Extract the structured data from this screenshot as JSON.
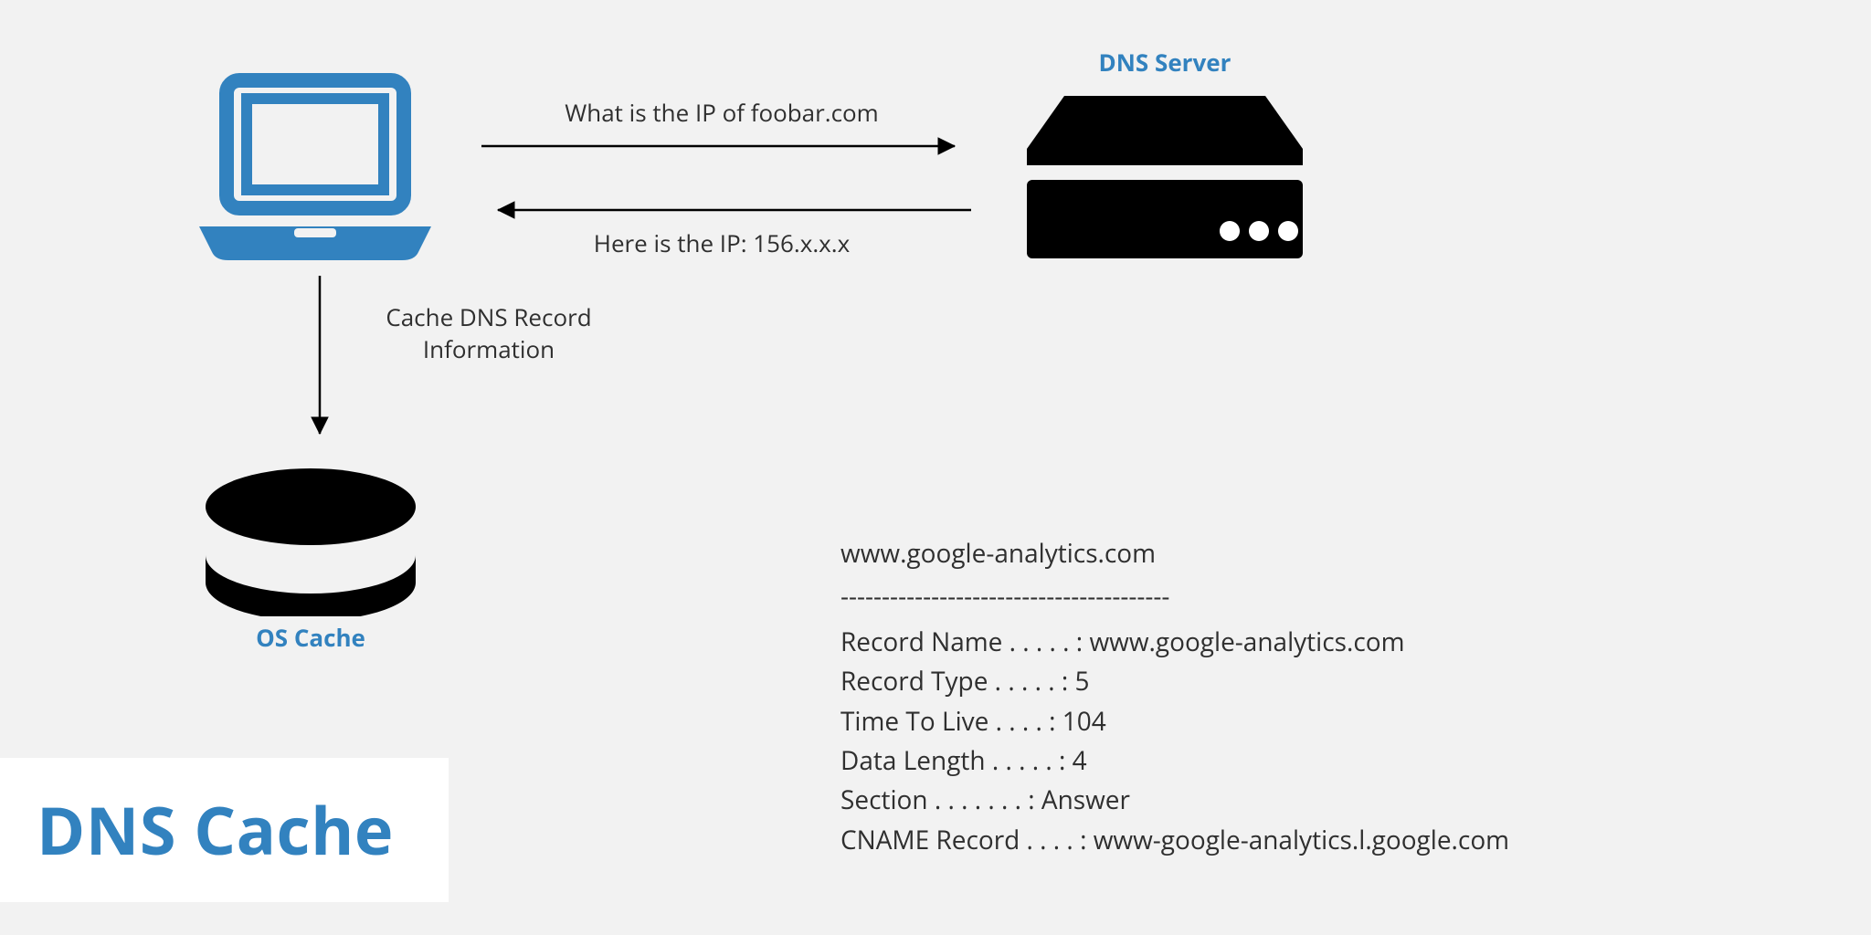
{
  "title": "DNS Cache",
  "labels": {
    "dns_server": "DNS Server",
    "os_cache": "OS Cache"
  },
  "arrows": {
    "request": "What is the IP of foobar.com",
    "response": "Here is the IP: 156.x.x.x",
    "cache_line1": "Cache DNS Record",
    "cache_line2": "Information"
  },
  "record": {
    "host": "www.google-analytics.com",
    "separator": "----------------------------------------",
    "name_label": "Record Name . . . . . :",
    "name_value": "www.google-analytics.com",
    "type_label": "Record Type . . . . . :",
    "type_value": "5",
    "ttl_label": "Time To Live  . . . . :",
    "ttl_value": "104",
    "length_label": "Data Length . . . . . :",
    "length_value": "4",
    "section_label": "Section . . . . . . . :",
    "section_value": "Answer",
    "cname_label": "CNAME Record  . . . . :",
    "cname_value": "www-google-analytics.l.google.com"
  },
  "colors": {
    "accent": "#3282bf",
    "ink": "#000000",
    "text": "#2f2f2f",
    "bg": "#f2f2f2"
  }
}
